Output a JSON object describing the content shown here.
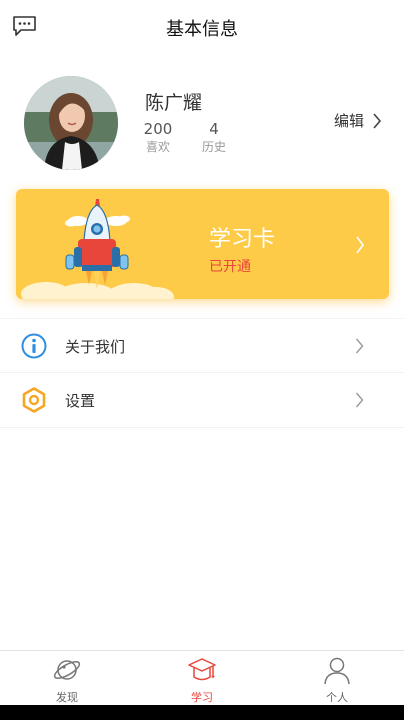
{
  "header": {
    "title": "基本信息",
    "left_icon": "message-icon"
  },
  "profile": {
    "name": "陈广耀",
    "stats": [
      {
        "value": "200",
        "label": "喜欢"
      },
      {
        "value": "4",
        "label": "历史"
      }
    ],
    "edit_label": "编辑"
  },
  "study_card": {
    "title": "学习卡",
    "status": "已开通",
    "background": "#fecb48",
    "status_color": "#e8463a"
  },
  "menu": [
    {
      "label": "关于我们",
      "icon": "info-icon",
      "color": "#2f8fe0"
    },
    {
      "label": "设置",
      "icon": "hexagon-settings-icon",
      "color": "#f5a623"
    }
  ],
  "tabs": [
    {
      "label": "发现",
      "icon": "planet-icon",
      "active": false
    },
    {
      "label": "学习",
      "icon": "graduation-cap-icon",
      "active": true
    },
    {
      "label": "个人",
      "icon": "user-icon",
      "active": false
    }
  ],
  "accent_color": "#e8463a"
}
